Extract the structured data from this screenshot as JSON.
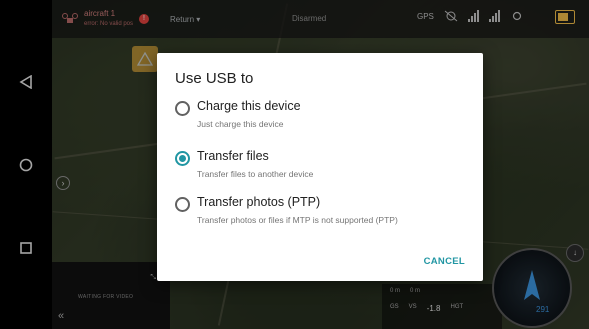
{
  "android_nav": {
    "back_icon": "back-triangle-icon",
    "home_icon": "home-circle-icon",
    "recents_icon": "recents-square-icon"
  },
  "topbar": {
    "drone_line1": "aircraft 1",
    "drone_line2": "error: No valid pos",
    "error_count": "!",
    "return_label": "Return ▾",
    "status_center": "Disarmed",
    "gps_label": "GPS"
  },
  "video": {
    "status": "WAITING FOR VIDEO",
    "collapse_glyph": "«",
    "expand_glyph": "⤡"
  },
  "telemetry": {
    "row1": [
      "0 m",
      "0 m"
    ],
    "row2": [
      "GS",
      "VS",
      "-1.8",
      "HGT"
    ]
  },
  "compass": {
    "button_glyph": "↓",
    "heading": "291"
  },
  "dialog": {
    "title": "Use USB to",
    "options": [
      {
        "label": "Charge this device",
        "sub": "Just charge this device",
        "selected": false
      },
      {
        "label": "Transfer files",
        "sub": "Transfer files to another device",
        "selected": true
      },
      {
        "label": "Transfer photos (PTP)",
        "sub": "Transfer photos or files if MTP is not supported (PTP)",
        "selected": false
      }
    ],
    "cancel_label": "CANCEL"
  },
  "colors": {
    "accent": "#2196a3",
    "warning": "#e0a93a",
    "battery": "#e8b646",
    "error": "#d9403d"
  }
}
